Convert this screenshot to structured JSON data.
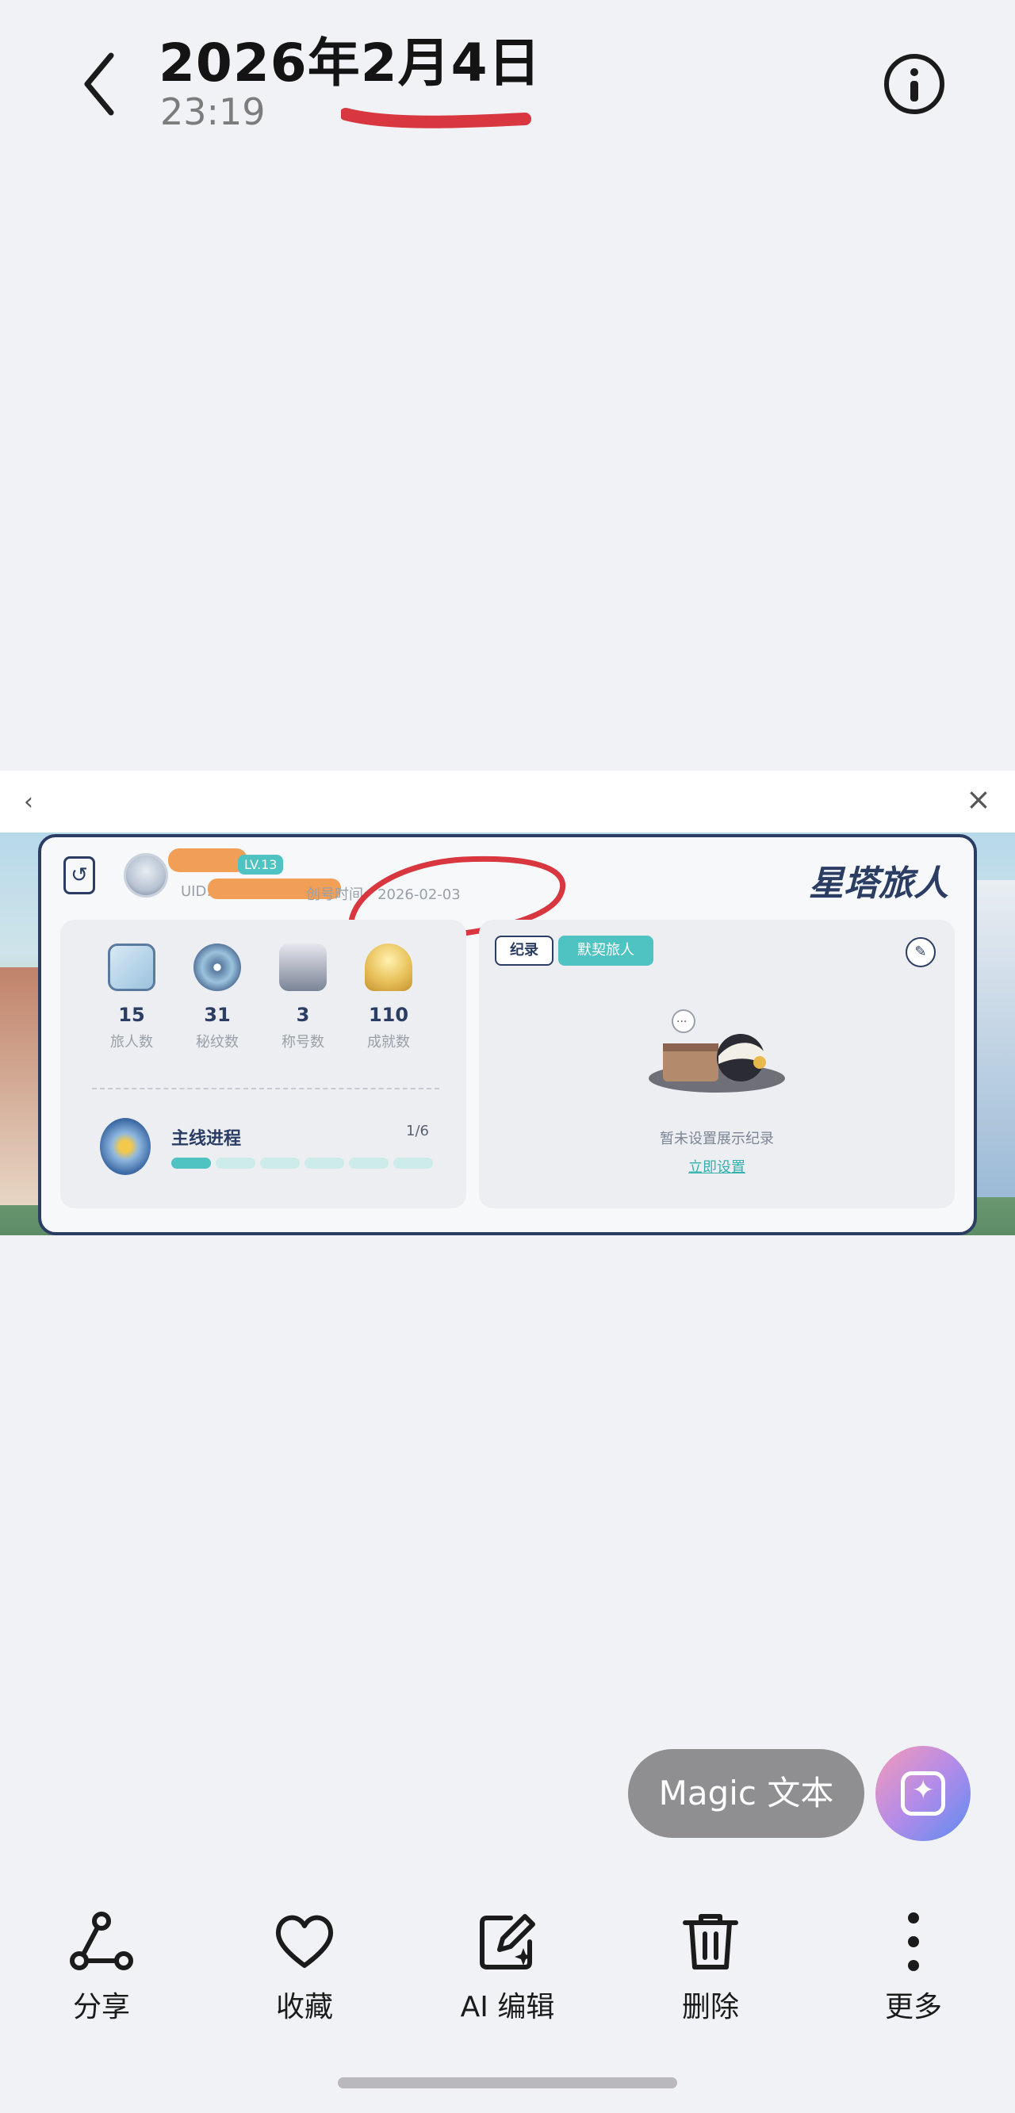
{
  "header": {
    "title": "2026年2月4日",
    "time": "23:19"
  },
  "screenshot": {
    "profile": {
      "level": "LV.13",
      "uid_label": "UID:",
      "created_label": "创号时间:",
      "created_value": "2026-02-03",
      "logo": "星塔旅人"
    },
    "stats": [
      {
        "value": "15",
        "label": "旅人数",
        "icon": "book-icon"
      },
      {
        "value": "31",
        "label": "秘纹数",
        "icon": "disc-icon"
      },
      {
        "value": "3",
        "label": "称号数",
        "icon": "chess-icon"
      },
      {
        "value": "110",
        "label": "成就数",
        "icon": "trophy-icon"
      }
    ],
    "mission": {
      "label": "主线进程",
      "count": "1/6",
      "progress_fraction": 0.1667
    },
    "record": {
      "tab_record": "纪录",
      "tab_default": "默契旅人",
      "empty_text": "暂未设置展示纪录",
      "setup_link": "立即设置"
    }
  },
  "magic": {
    "label": "Magic 文本"
  },
  "toolbar": {
    "items": [
      {
        "label": "分享",
        "icon": "share-icon"
      },
      {
        "label": "收藏",
        "icon": "heart-icon"
      },
      {
        "label": "AI 编辑",
        "icon": "ai-edit-icon"
      },
      {
        "label": "删除",
        "icon": "trash-icon"
      },
      {
        "label": "更多",
        "icon": "more-icon"
      }
    ]
  },
  "colors": {
    "accent_teal": "#4ec3c1",
    "panel_border": "#2b3d63",
    "annotation_red": "#d9373f",
    "redaction_orange": "#f09a4e"
  }
}
